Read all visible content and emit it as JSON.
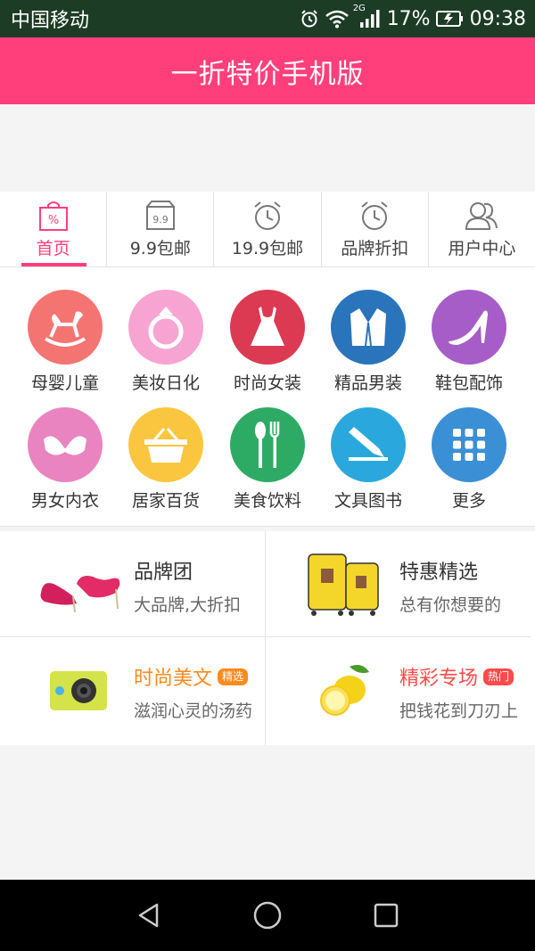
{
  "status_bar": {
    "carrier": "中国移动",
    "network": "2G",
    "battery_percent": "17%",
    "time": "09:38",
    "icons": [
      "alarm-icon",
      "wifi-icon",
      "signal-icon",
      "battery-charging-icon"
    ]
  },
  "header": {
    "title": "一折特价手机版"
  },
  "tabs": [
    {
      "label": "首页",
      "icon": "shopping-bag-icon",
      "icon_text": "%",
      "active": true
    },
    {
      "label": "9.9包邮",
      "icon": "box-icon",
      "icon_text": "9.9"
    },
    {
      "label": "19.9包邮",
      "icon": "alarm-clock-icon"
    },
    {
      "label": "品牌折扣",
      "icon": "alarm-clock-icon"
    },
    {
      "label": "用户中心",
      "icon": "users-icon"
    }
  ],
  "categories": [
    {
      "label": "母婴儿童",
      "icon": "rocking-horse-icon",
      "color": "#f47472"
    },
    {
      "label": "美妆日化",
      "icon": "ring-icon",
      "color": "#f8a4d2"
    },
    {
      "label": "时尚女装",
      "icon": "dress-icon",
      "color": "#dc3a52"
    },
    {
      "label": "精品男装",
      "icon": "suit-icon",
      "color": "#2a74bb"
    },
    {
      "label": "鞋包配饰",
      "icon": "high-heel-icon",
      "color": "#a65dc8"
    },
    {
      "label": "男女内衣",
      "icon": "bra-icon",
      "color": "#ea84c0"
    },
    {
      "label": "居家百货",
      "icon": "basket-icon",
      "color": "#fbc63f"
    },
    {
      "label": "美食饮料",
      "icon": "cutlery-icon",
      "color": "#2dab64"
    },
    {
      "label": "文具图书",
      "icon": "pencil-icon",
      "color": "#2aa8dd"
    },
    {
      "label": "更多",
      "icon": "grid-icon",
      "color": "#3b8fd5"
    }
  ],
  "promos": [
    {
      "title": "品牌团",
      "subtitle": "大品牌,大折扣",
      "image": "pink-heels-image",
      "title_color": "#333333"
    },
    {
      "title": "特惠精选",
      "subtitle": "总有你想要的",
      "image": "yellow-luggage-image",
      "title_color": "#333333"
    },
    {
      "title": "时尚美文",
      "subtitle": "滋润心灵的汤药",
      "image": "action-camera-image",
      "title_color": "#ff8a1e",
      "badge": "精选",
      "badge_color": "#ff8a1e"
    },
    {
      "title": "精彩专场",
      "subtitle": "把钱花到刀刃上",
      "image": "lemons-image",
      "title_color": "#ff4a4a",
      "badge": "热门",
      "badge_color": "#ff4a4a"
    }
  ],
  "nav_bar": {
    "buttons": [
      "back-icon",
      "home-icon",
      "recents-icon"
    ]
  },
  "colors": {
    "accent": "#ff3f7b",
    "status_bar": "#1c3c25"
  }
}
